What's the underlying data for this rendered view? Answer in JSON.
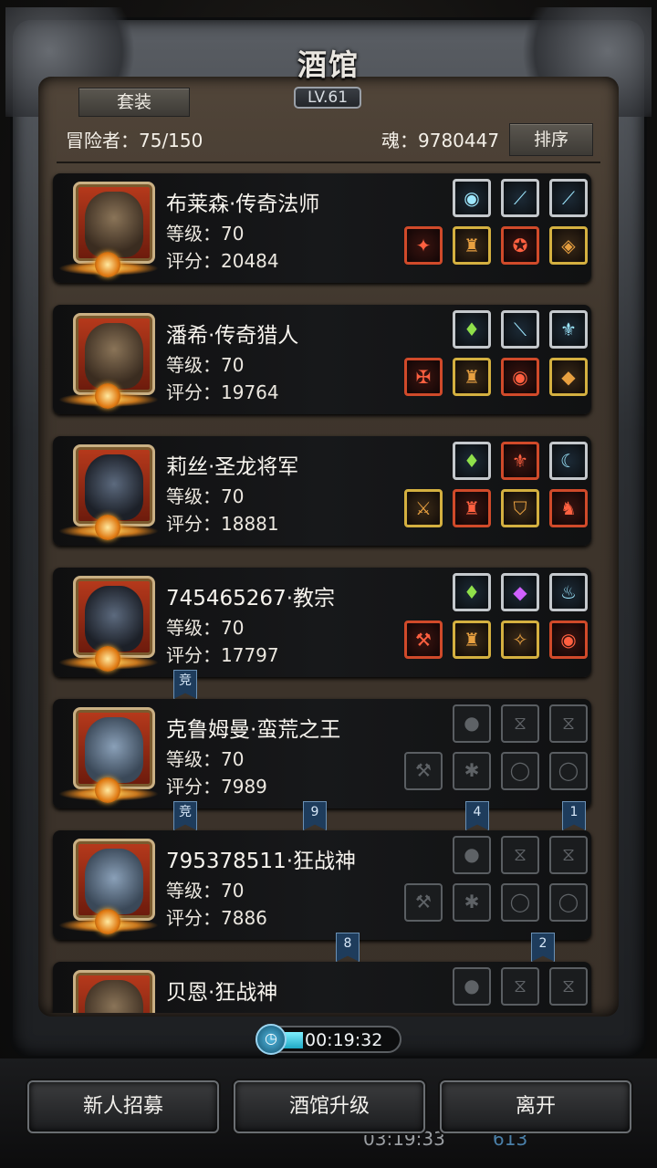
{
  "header": {
    "title": "酒馆",
    "level": "LV.61",
    "set_button": "套装",
    "adventurers": "冒险者：75/150",
    "soul": "魂：9780447",
    "sort_button": "排序"
  },
  "heroes": [
    {
      "name": "布莱森·传奇法师",
      "level": "等级：70",
      "score": "评分：20484",
      "face": "light",
      "top_slots": [
        {
          "icon": "orb-icon",
          "glyph": "◉",
          "style": ""
        },
        {
          "icon": "bow-icon",
          "glyph": "⟋",
          "style": ""
        },
        {
          "icon": "blade-icon",
          "glyph": "⟋",
          "style": ""
        }
      ],
      "bottom_slots": [
        {
          "icon": "staff-icon",
          "glyph": "✦",
          "style": "red"
        },
        {
          "icon": "robe-icon",
          "glyph": "♜",
          "style": "gold"
        },
        {
          "icon": "amulet-icon",
          "glyph": "✪",
          "style": "red"
        },
        {
          "icon": "ring-icon",
          "glyph": "◈",
          "style": "gold"
        }
      ]
    },
    {
      "name": "潘希·传奇猎人",
      "level": "等级：70",
      "score": "评分：19764",
      "face": "light",
      "top_slots": [
        {
          "icon": "green-gem-icon",
          "glyph": "♦",
          "style": "green"
        },
        {
          "icon": "dagger-icon",
          "glyph": "⟍",
          "style": ""
        },
        {
          "icon": "horn-icon",
          "glyph": "⚜",
          "style": ""
        }
      ],
      "bottom_slots": [
        {
          "icon": "crossbow-icon",
          "glyph": "✠",
          "style": "red"
        },
        {
          "icon": "armor-icon",
          "glyph": "♜",
          "style": "gold"
        },
        {
          "icon": "eye-icon",
          "glyph": "◉",
          "style": "red"
        },
        {
          "icon": "bracer-icon",
          "glyph": "◆",
          "style": "gold"
        }
      ]
    },
    {
      "name": "莉丝·圣龙将军",
      "level": "等级：70",
      "score": "评分：18881",
      "face": "dark",
      "top_slots": [
        {
          "icon": "green-gem-icon",
          "glyph": "♦",
          "style": "green"
        },
        {
          "icon": "crest-icon",
          "glyph": "⚜",
          "style": "red"
        },
        {
          "icon": "claw-icon",
          "glyph": "☾",
          "style": ""
        }
      ],
      "bottom_slots": [
        {
          "icon": "sword-icon",
          "glyph": "⚔",
          "style": "gold"
        },
        {
          "icon": "armor-icon",
          "glyph": "♜",
          "style": "red"
        },
        {
          "icon": "shield-icon",
          "glyph": "⛉",
          "style": "gold"
        },
        {
          "icon": "helmet-icon",
          "glyph": "♞",
          "style": "red"
        }
      ]
    },
    {
      "name": "745465267·教宗",
      "level": "等级：70",
      "score": "评分：17797",
      "face": "dark",
      "top_slots": [
        {
          "icon": "green-gem-icon",
          "glyph": "♦",
          "style": "green"
        },
        {
          "icon": "purple-gem-icon",
          "glyph": "◆",
          "style": "purple"
        },
        {
          "icon": "flask-icon",
          "glyph": "♨",
          "style": ""
        }
      ],
      "bottom_slots": [
        {
          "icon": "hammer-icon",
          "glyph": "⚒",
          "style": "red"
        },
        {
          "icon": "armor-icon",
          "glyph": "♜",
          "style": "gold"
        },
        {
          "icon": "pendant-icon",
          "glyph": "✧",
          "style": "gold"
        },
        {
          "icon": "orb-icon",
          "glyph": "◉",
          "style": "red"
        }
      ]
    },
    {
      "name": "克鲁姆曼·蛮荒之王",
      "level": "等级：70",
      "score": "评分：7989",
      "face": "blue",
      "top_slots": [
        {
          "icon": "empty-drop-icon",
          "glyph": "●",
          "style": "empty"
        },
        {
          "icon": "empty-hourglass-icon",
          "glyph": "⧖",
          "style": "empty"
        },
        {
          "icon": "empty-hourglass-icon",
          "glyph": "⧖",
          "style": "empty"
        }
      ],
      "bottom_slots": [
        {
          "icon": "empty-axe-icon",
          "glyph": "⚒",
          "style": "empty"
        },
        {
          "icon": "empty-armor-icon",
          "glyph": "✱",
          "style": "empty"
        },
        {
          "icon": "empty-ring-icon",
          "glyph": "◯",
          "style": "empty"
        },
        {
          "icon": "empty-ring-icon",
          "glyph": "◯",
          "style": "empty"
        }
      ]
    },
    {
      "name": "795378511·狂战神",
      "level": "等级：70",
      "score": "评分：7886",
      "face": "blue",
      "top_slots": [
        {
          "icon": "empty-drop-icon",
          "glyph": "●",
          "style": "empty"
        },
        {
          "icon": "empty-hourglass-icon",
          "glyph": "⧖",
          "style": "empty"
        },
        {
          "icon": "empty-hourglass-icon",
          "glyph": "⧖",
          "style": "empty"
        }
      ],
      "bottom_slots": [
        {
          "icon": "empty-axe-icon",
          "glyph": "⚒",
          "style": "empty"
        },
        {
          "icon": "empty-armor-icon",
          "glyph": "✱",
          "style": "empty"
        },
        {
          "icon": "empty-ring-icon",
          "glyph": "◯",
          "style": "empty"
        },
        {
          "icon": "empty-ring-icon",
          "glyph": "◯",
          "style": "empty"
        }
      ]
    },
    {
      "name": "贝恩·狂战神",
      "level": "",
      "score": "",
      "face": "light",
      "top_slots": [
        {
          "icon": "empty-drop-icon",
          "glyph": "●",
          "style": "empty"
        },
        {
          "icon": "empty-hourglass-icon",
          "glyph": "⧖",
          "style": "empty"
        },
        {
          "icon": "empty-hourglass-icon",
          "glyph": "⧖",
          "style": "empty"
        }
      ],
      "bottom_slots": []
    }
  ],
  "markers": [
    {
      "text": "竞"
    },
    {
      "text": "竞"
    },
    {
      "text": "9"
    },
    {
      "text": "4"
    },
    {
      "text": "1"
    },
    {
      "text": "8"
    },
    {
      "text": "2"
    }
  ],
  "timer": "00:19:32",
  "footer": {
    "recruit": "新人招募",
    "upgrade": "酒馆升级",
    "leave": "离开",
    "clock": "03:19:33",
    "gems": "613"
  }
}
